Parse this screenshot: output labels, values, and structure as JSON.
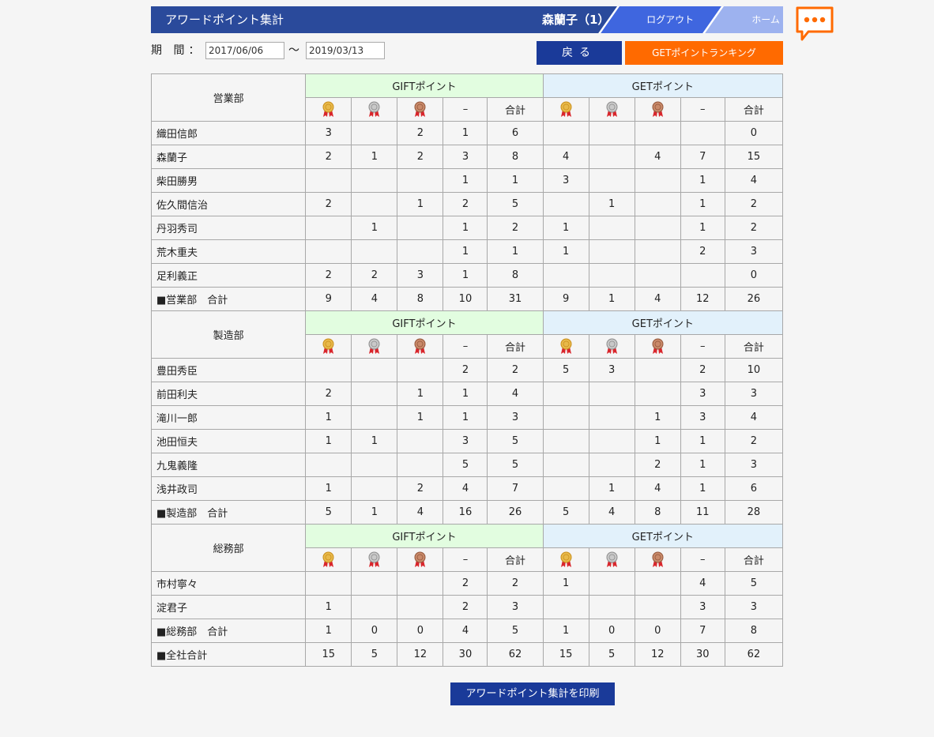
{
  "header": {
    "title": "アワードポイント集計",
    "user": "森蘭子（1）",
    "logout": "ログアウト",
    "home": "ホーム"
  },
  "period": {
    "label": "期 間：",
    "from": "2017/06/06",
    "tilde": "～",
    "to": "2019/03/13"
  },
  "buttons": {
    "back": "戻る",
    "ranking": "GETポイントランキング",
    "print": "アワードポイント集計を印刷"
  },
  "colors": {
    "header": "#2a4a9b",
    "logout": "#3f66df",
    "home": "#9db2ef",
    "accent_orange": "#ff6a00",
    "button_navy": "#1a3a99",
    "gift_header_bg": "#e2fde0",
    "get_header_bg": "#e2f1fb"
  },
  "table": {
    "gift_label": "GIFTポイント",
    "get_label": "GETポイント",
    "columns": [
      "gold-medal-icon",
      "silver-medal-icon",
      "bronze-medal-icon",
      "–",
      "合計",
      "gold-medal-icon",
      "silver-medal-icon",
      "bronze-medal-icon",
      "–",
      "合計"
    ],
    "dash": "–",
    "total": "合計",
    "departments": [
      {
        "name": "営業部",
        "rows": [
          {
            "name": "織田信郎",
            "v": [
              "3",
              "",
              "2",
              "1",
              "6",
              "",
              "",
              "",
              "",
              "0"
            ]
          },
          {
            "name": "森蘭子",
            "v": [
              "2",
              "1",
              "2",
              "3",
              "8",
              "4",
              "",
              "4",
              "7",
              "15"
            ]
          },
          {
            "name": "柴田勝男",
            "v": [
              "",
              "",
              "",
              "1",
              "1",
              "3",
              "",
              "",
              "1",
              "4"
            ]
          },
          {
            "name": "佐久間信治",
            "v": [
              "2",
              "",
              "1",
              "2",
              "5",
              "",
              "1",
              "",
              "1",
              "2"
            ]
          },
          {
            "name": "丹羽秀司",
            "v": [
              "",
              "1",
              "",
              "1",
              "2",
              "1",
              "",
              "",
              "1",
              "2"
            ]
          },
          {
            "name": "荒木重夫",
            "v": [
              "",
              "",
              "",
              "1",
              "1",
              "1",
              "",
              "",
              "2",
              "3"
            ]
          },
          {
            "name": "足利義正",
            "v": [
              "2",
              "2",
              "3",
              "1",
              "8",
              "",
              "",
              "",
              "",
              "0"
            ]
          }
        ],
        "subtotal": {
          "name": "■営業部　合計",
          "v": [
            "9",
            "4",
            "8",
            "10",
            "31",
            "9",
            "1",
            "4",
            "12",
            "26"
          ]
        }
      },
      {
        "name": "製造部",
        "rows": [
          {
            "name": "豊田秀臣",
            "v": [
              "",
              "",
              "",
              "2",
              "2",
              "5",
              "3",
              "",
              "2",
              "10"
            ]
          },
          {
            "name": "前田利夫",
            "v": [
              "2",
              "",
              "1",
              "1",
              "4",
              "",
              "",
              "",
              "3",
              "3"
            ]
          },
          {
            "name": "滝川一郎",
            "v": [
              "1",
              "",
              "1",
              "1",
              "3",
              "",
              "",
              "1",
              "3",
              "4"
            ]
          },
          {
            "name": "池田恒夫",
            "v": [
              "1",
              "1",
              "",
              "3",
              "5",
              "",
              "",
              "1",
              "1",
              "2"
            ]
          },
          {
            "name": "九鬼義隆",
            "v": [
              "",
              "",
              "",
              "5",
              "5",
              "",
              "",
              "2",
              "1",
              "3"
            ]
          },
          {
            "name": "浅井政司",
            "v": [
              "1",
              "",
              "2",
              "4",
              "7",
              "",
              "1",
              "4",
              "1",
              "6"
            ]
          }
        ],
        "subtotal": {
          "name": "■製造部　合計",
          "v": [
            "5",
            "1",
            "4",
            "16",
            "26",
            "5",
            "4",
            "8",
            "11",
            "28"
          ]
        }
      },
      {
        "name": "総務部",
        "rows": [
          {
            "name": "市村寧々",
            "v": [
              "",
              "",
              "",
              "2",
              "2",
              "1",
              "",
              "",
              "4",
              "5"
            ]
          },
          {
            "name": "淀君子",
            "v": [
              "1",
              "",
              "",
              "2",
              "3",
              "",
              "",
              "",
              "3",
              "3"
            ]
          }
        ],
        "subtotal": {
          "name": "■総務部　合計",
          "v": [
            "1",
            "0",
            "0",
            "4",
            "5",
            "1",
            "0",
            "0",
            "7",
            "8"
          ]
        }
      }
    ],
    "grand_total": {
      "name": "■全社合計",
      "v": [
        "15",
        "5",
        "12",
        "30",
        "62",
        "15",
        "5",
        "12",
        "30",
        "62"
      ]
    }
  }
}
